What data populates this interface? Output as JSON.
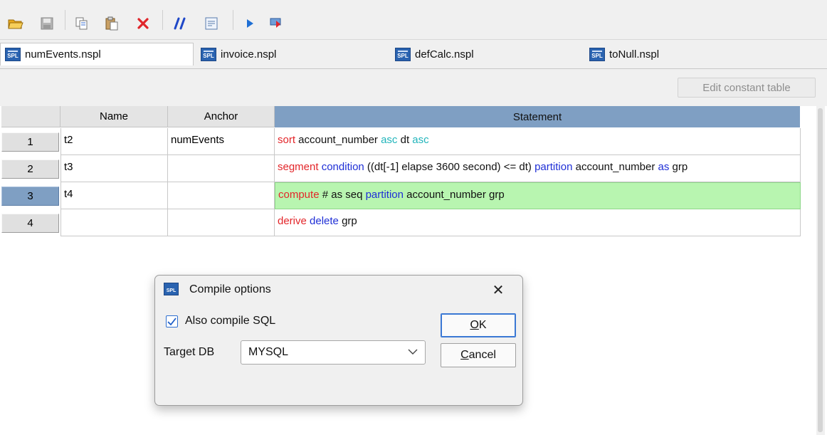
{
  "toolbar": {
    "buttons": [
      {
        "name": "open-folder-icon"
      },
      {
        "name": "save-icon"
      },
      {
        "name": "copy-icon"
      },
      {
        "name": "paste-icon"
      },
      {
        "name": "delete-icon"
      },
      {
        "name": "comment-icon"
      },
      {
        "name": "form-icon"
      },
      {
        "name": "run-icon"
      },
      {
        "name": "step-icon"
      }
    ],
    "colors": {
      "delete": "#e0262b",
      "comment": "#1f48c8",
      "run": "#1f6fd4",
      "open": "#e8a81c"
    }
  },
  "tabs": [
    {
      "label": "numEvents.nspl",
      "active": true
    },
    {
      "label": "invoice.nspl",
      "active": false
    },
    {
      "label": "defCalc.nspl",
      "active": false
    },
    {
      "label": "toNull.nspl",
      "active": false
    }
  ],
  "edit_constant_table": "Edit constant table",
  "table": {
    "headers": {
      "name": "Name",
      "anchor": "Anchor",
      "statement": "Statement"
    },
    "rows": [
      {
        "num": "1",
        "name": "t2",
        "anchor": "numEvents",
        "statement": [
          {
            "t": "sort",
            "c": "red"
          },
          {
            "t": " account_number ",
            "c": "blk"
          },
          {
            "t": "asc",
            "c": "teal"
          },
          {
            "t": " dt ",
            "c": "blk"
          },
          {
            "t": "asc",
            "c": "teal"
          }
        ]
      },
      {
        "num": "2",
        "name": "t3",
        "anchor": "",
        "statement": [
          {
            "t": "segment",
            "c": "red"
          },
          {
            "t": " ",
            "c": "blk"
          },
          {
            "t": "condition",
            "c": "blue"
          },
          {
            "t": " ((dt[-1] elapse 3600 second) <= dt) ",
            "c": "blk"
          },
          {
            "t": "partition",
            "c": "blue"
          },
          {
            "t": " account_number ",
            "c": "blk"
          },
          {
            "t": "as",
            "c": "blue"
          },
          {
            "t": " grp",
            "c": "blk"
          }
        ]
      },
      {
        "num": "3",
        "name": "t4",
        "anchor": "",
        "selected": true,
        "statement": [
          {
            "t": "compute",
            "c": "red"
          },
          {
            "t": " # as seq ",
            "c": "blk"
          },
          {
            "t": "partition",
            "c": "blue"
          },
          {
            "t": " account_number grp",
            "c": "blk"
          }
        ]
      },
      {
        "num": "4",
        "name": "",
        "anchor": "",
        "statement": [
          {
            "t": "derive",
            "c": "red"
          },
          {
            "t": " ",
            "c": "blk"
          },
          {
            "t": "delete",
            "c": "blue"
          },
          {
            "t": " grp",
            "c": "blk"
          }
        ]
      }
    ]
  },
  "dialog": {
    "title": "Compile options",
    "close": "✕",
    "also_compile_sql": "Also compile SQL",
    "also_compile_sql_checked": true,
    "target_db_label": "Target DB",
    "target_db_value": "MYSQL",
    "ok_underlined": "O",
    "ok_rest": "K",
    "cancel_underlined": "C",
    "cancel_rest": "ancel"
  },
  "icon_text": "SPL"
}
